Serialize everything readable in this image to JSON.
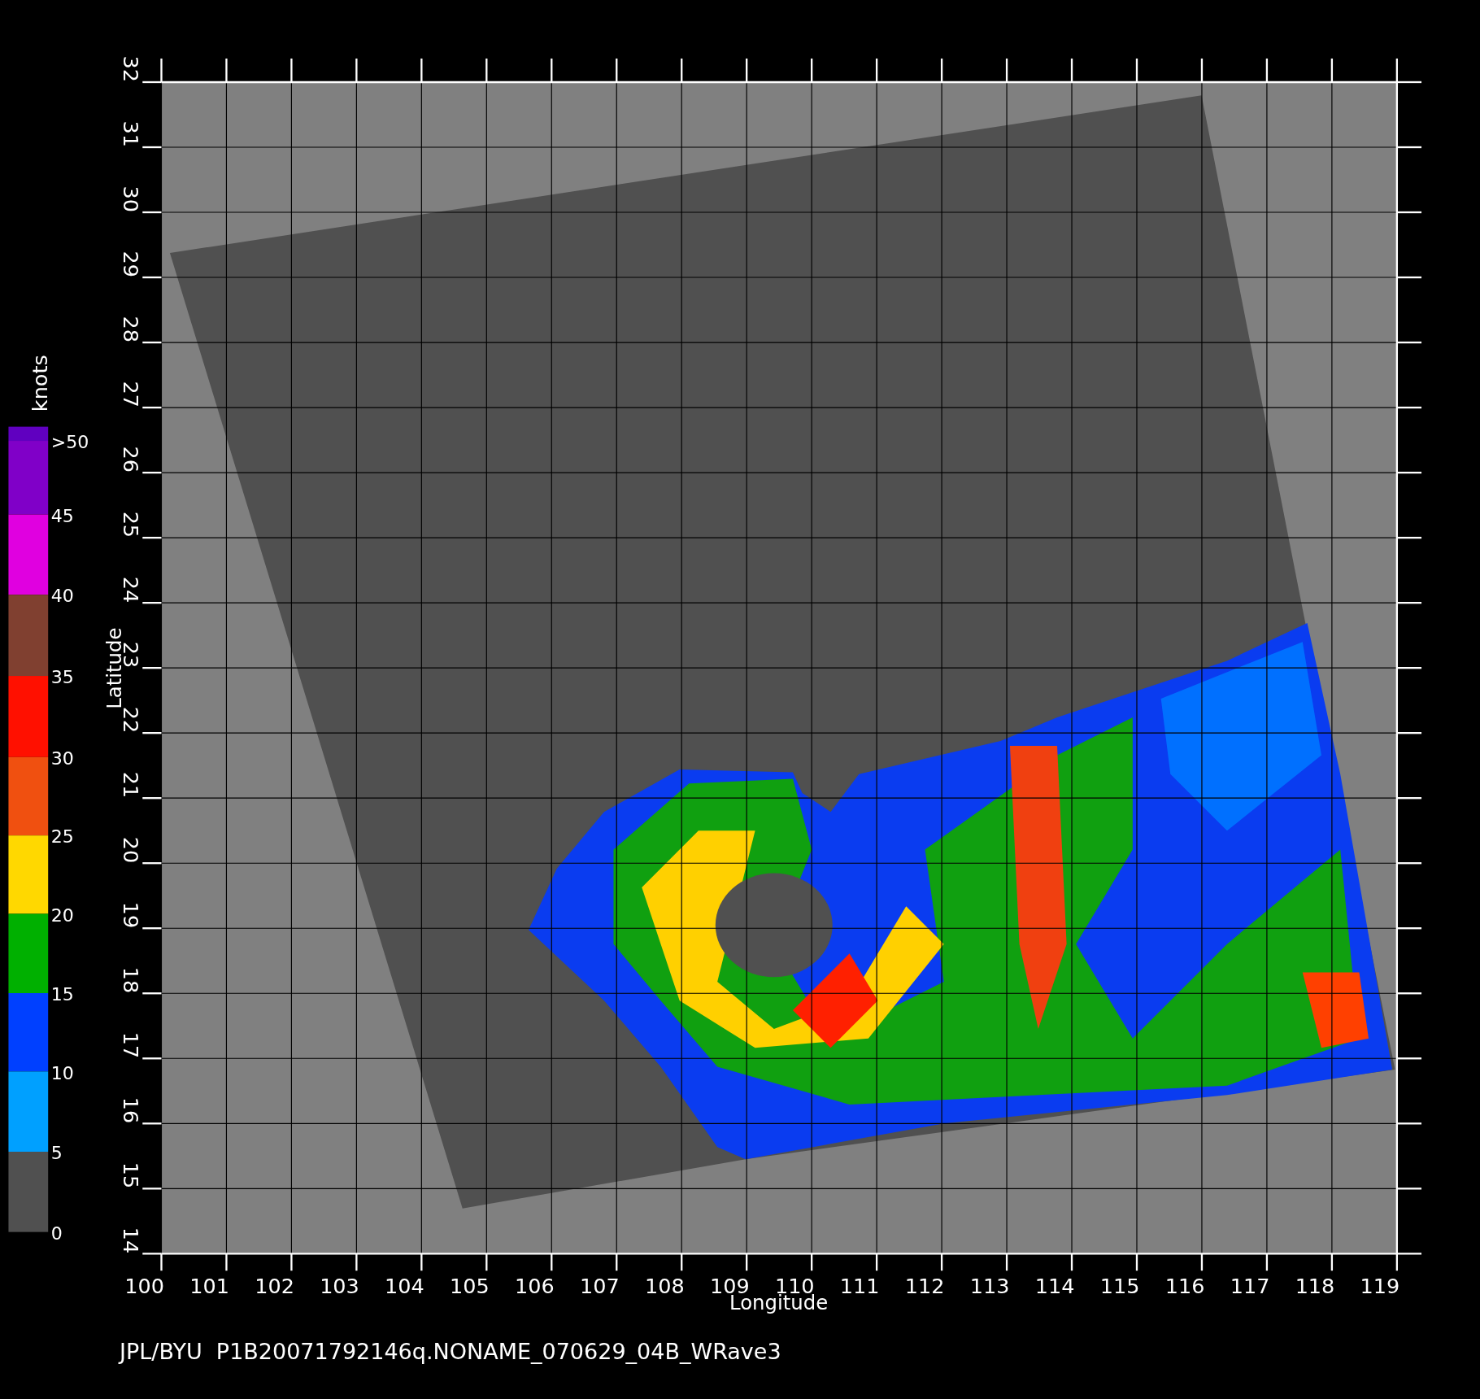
{
  "plot": {
    "x_axis": {
      "label": "Longitude",
      "ticks": [
        "100",
        "101",
        "102",
        "103",
        "104",
        "105",
        "106",
        "107",
        "108",
        "109",
        "110",
        "111",
        "112",
        "113",
        "114",
        "115",
        "116",
        "117",
        "118",
        "119"
      ]
    },
    "y_axis": {
      "label": "Latitude",
      "ticks": [
        "32",
        "31",
        "30",
        "29",
        "28",
        "27",
        "26",
        "25",
        "24",
        "23",
        "22",
        "21",
        "20",
        "19",
        "18",
        "17",
        "16",
        "15",
        "14"
      ]
    }
  },
  "colorbar": {
    "unit": "knots",
    "scale": [
      {
        "label": ">50",
        "color": "#6000c0"
      },
      {
        "label": "45",
        "color": "#8000c8"
      },
      {
        "label": "40",
        "color": "#e000e0"
      },
      {
        "label": "35",
        "color": "#804030"
      },
      {
        "label": "30",
        "color": "#ff1000"
      },
      {
        "label": "25",
        "color": "#f05010"
      },
      {
        "label": "20",
        "color": "#ffd800"
      },
      {
        "label": "15",
        "color": "#00b000"
      },
      {
        "label": "10",
        "color": "#0040ff"
      },
      {
        "label": "5",
        "color": "#00a0ff"
      },
      {
        "label": "0",
        "color": "#505050"
      }
    ]
  },
  "caption": "JPL/BYU  P1B20071792146q.NONAME_070629_04B_WRave3"
}
